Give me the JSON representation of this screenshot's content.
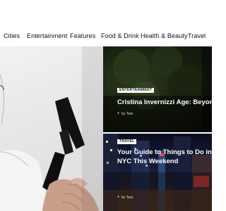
{
  "nav": {
    "items": [
      "Cities",
      "Entertainment",
      "Features",
      "Food & Drink",
      "Health & Beauty",
      "Travel"
    ]
  },
  "cards": [
    {
      "badge": "ENTERTAINMENT",
      "title": "Cristina Invernizzi Age: Beyond",
      "byline": "by Tara"
    },
    {
      "badge": "TRAVEL",
      "title_line1": "Your Guide to Things to Do in",
      "title_line2": "NYC This Weekend",
      "byline": "by Tara"
    }
  ],
  "colors": {
    "text": "#111111",
    "badge_bg": "#ffffff",
    "card_title": "#ffffff"
  }
}
